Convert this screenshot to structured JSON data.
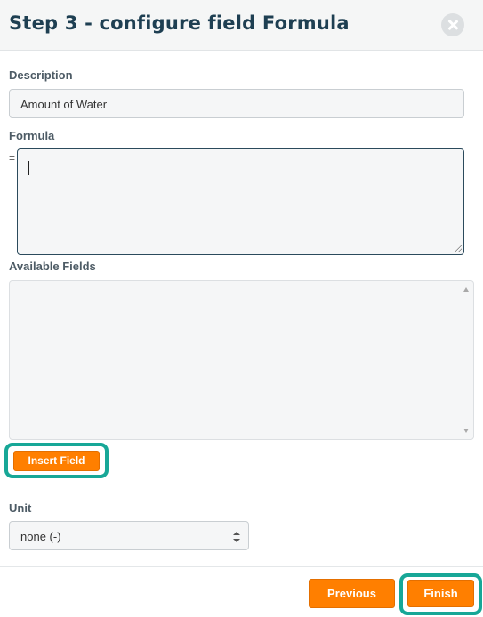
{
  "header": {
    "title": "Step 3 - configure field Formula",
    "close_icon": "close-circle-icon"
  },
  "description": {
    "label": "Description",
    "value": "Amount of Water"
  },
  "formula": {
    "label": "Formula",
    "prefix": "=",
    "value": ""
  },
  "available_fields": {
    "label": "Available Fields",
    "items": []
  },
  "insert_field": {
    "label": "Insert Field"
  },
  "unit": {
    "label": "Unit",
    "selected": "none (-)"
  },
  "footer": {
    "previous_label": "Previous",
    "finish_label": "Finish"
  },
  "colors": {
    "accent": "#ff7f00",
    "highlight": "#17a797",
    "title": "#1e3f52"
  }
}
